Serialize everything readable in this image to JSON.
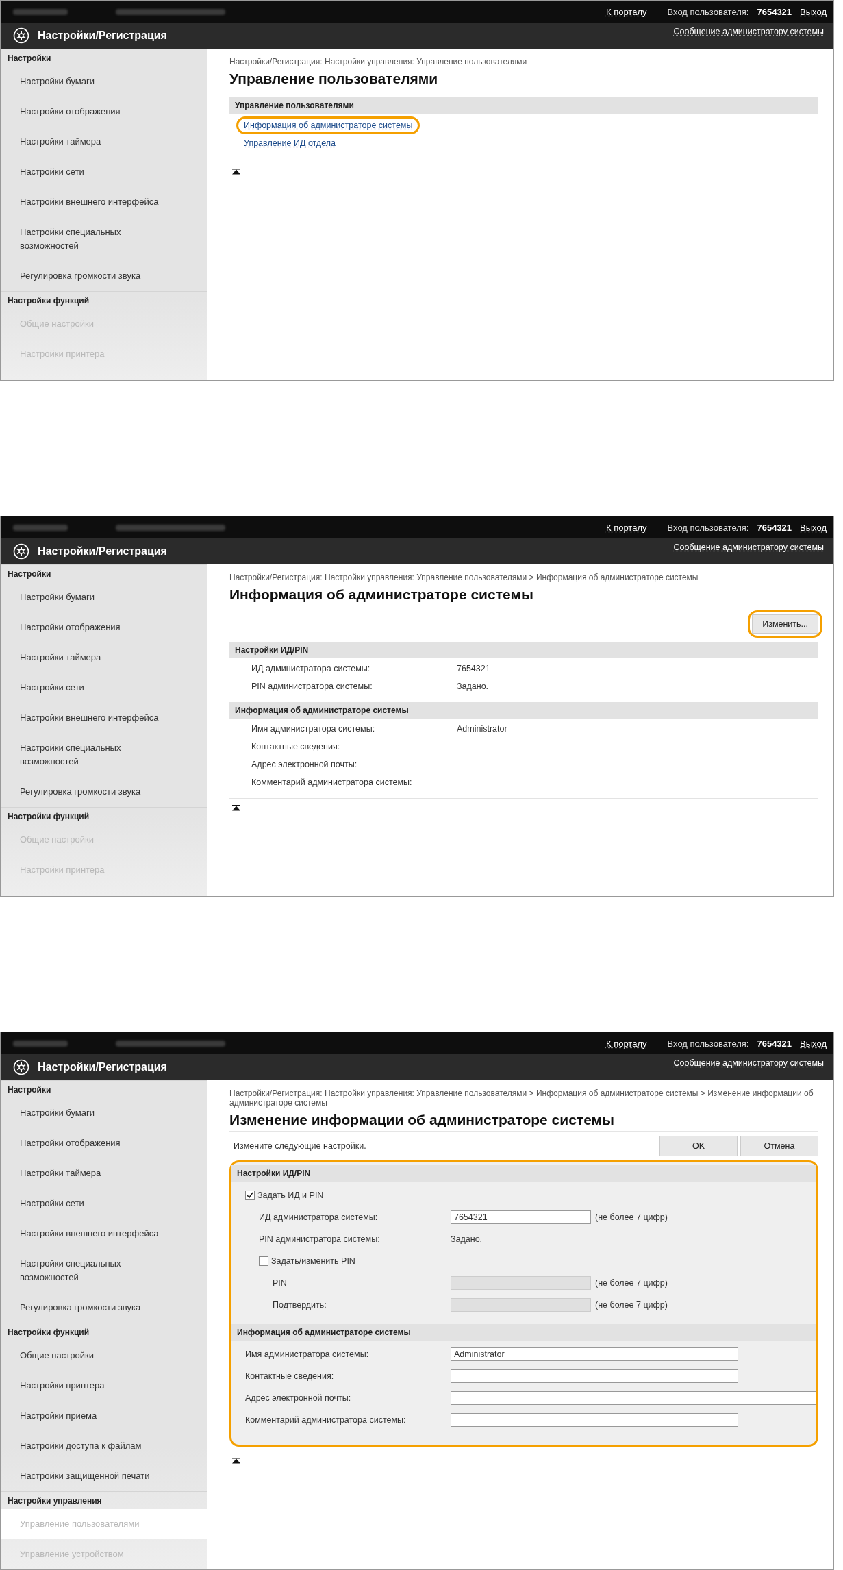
{
  "screens": [
    {
      "kind": "menu",
      "top_bar": {
        "portal_link": "К порталу",
        "login_label": "Вход пользователя:",
        "user": "7654321",
        "logout_link": "Выход"
      },
      "header": {
        "title": "Настройки/Регистрация",
        "message_link": "Сообщение администратору системы"
      },
      "sidebar": [
        {
          "heading": "Настройки",
          "items": [
            {
              "label": "Настройки бумаги",
              "selected": false,
              "faded": false
            },
            {
              "label": "Настройки отображения",
              "selected": false,
              "faded": false
            },
            {
              "label": "Настройки таймера",
              "selected": false,
              "faded": false
            },
            {
              "label": "Настройки сети",
              "selected": false,
              "faded": false
            },
            {
              "label": "Настройки внешнего интерфейса",
              "selected": false,
              "faded": false
            },
            {
              "label": "Настройки специальных возможностей",
              "selected": false,
              "faded": false
            },
            {
              "label": "Регулировка громкости звука",
              "selected": false,
              "faded": false
            }
          ]
        },
        {
          "heading": "Настройки функций",
          "items": [
            {
              "label": "Общие настройки",
              "selected": false,
              "faded": true
            },
            {
              "label": "Настройки принтера",
              "selected": false,
              "faded": true
            }
          ]
        }
      ],
      "breadcrumb": "Настройки/Регистрация: Настройки управления: Управление пользователями",
      "page_title": "Управление пользователями",
      "menu_section": {
        "heading": "Управление пользователями",
        "links": [
          {
            "label": "Информация об администраторе системы",
            "highlighted": true
          },
          {
            "label": "Управление ИД отдела",
            "highlighted": false
          }
        ]
      }
    },
    {
      "kind": "info",
      "top_bar": {
        "portal_link": "К порталу",
        "login_label": "Вход пользователя:",
        "user": "7654321",
        "logout_link": "Выход"
      },
      "header": {
        "title": "Настройки/Регистрация",
        "message_link": "Сообщение администратору системы"
      },
      "sidebar": [
        {
          "heading": "Настройки",
          "items": [
            {
              "label": "Настройки бумаги",
              "selected": false,
              "faded": false
            },
            {
              "label": "Настройки отображения",
              "selected": false,
              "faded": false
            },
            {
              "label": "Настройки таймера",
              "selected": false,
              "faded": false
            },
            {
              "label": "Настройки сети",
              "selected": false,
              "faded": false
            },
            {
              "label": "Настройки внешнего интерфейса",
              "selected": false,
              "faded": false
            },
            {
              "label": "Настройки специальных возможностей",
              "selected": false,
              "faded": false
            },
            {
              "label": "Регулировка громкости звука",
              "selected": false,
              "faded": false
            }
          ]
        },
        {
          "heading": "Настройки функций",
          "items": [
            {
              "label": "Общие настройки",
              "selected": false,
              "faded": true
            },
            {
              "label": "Настройки принтера",
              "selected": false,
              "faded": true
            }
          ]
        }
      ],
      "breadcrumb": "Настройки/Регистрация: Настройки управления: Управление пользователями > Информация об администраторе системы",
      "page_title": "Информация об администраторе системы",
      "edit_button": {
        "label": "Изменить...",
        "highlighted": true
      },
      "sections": [
        {
          "heading": "Настройки ИД/PIN",
          "rows": [
            {
              "label": "ИД администратора системы:",
              "value": "7654321"
            },
            {
              "label": "PIN администратора системы:",
              "value": "Задано."
            }
          ]
        },
        {
          "heading": "Информация об администраторе системы",
          "rows": [
            {
              "label": "Имя администратора системы:",
              "value": "Administrator"
            },
            {
              "label": "Контактные сведения:"
            },
            {
              "label": "Адрес электронной почты:"
            },
            {
              "label": "Комментарий администратора системы:"
            }
          ]
        }
      ]
    },
    {
      "kind": "form",
      "top_bar": {
        "portal_link": "К порталу",
        "login_label": "Вход пользователя:",
        "user": "7654321",
        "logout_link": "Выход"
      },
      "header": {
        "title": "Настройки/Регистрация",
        "message_link": "Сообщение администратору системы"
      },
      "sidebar": [
        {
          "heading": "Настройки",
          "items": [
            {
              "label": "Настройки бумаги",
              "selected": false,
              "faded": false
            },
            {
              "label": "Настройки отображения",
              "selected": false,
              "faded": false
            },
            {
              "label": "Настройки таймера",
              "selected": false,
              "faded": false
            },
            {
              "label": "Настройки сети",
              "selected": false,
              "faded": false
            },
            {
              "label": "Настройки внешнего интерфейса",
              "selected": false,
              "faded": false
            },
            {
              "label": "Настройки специальных возможностей",
              "selected": false,
              "faded": false
            },
            {
              "label": "Регулировка громкости звука",
              "selected": false,
              "faded": false
            }
          ]
        },
        {
          "heading": "Настройки функций",
          "items": [
            {
              "label": "Общие настройки",
              "selected": false,
              "faded": false
            },
            {
              "label": "Настройки принтера",
              "selected": false,
              "faded": false
            },
            {
              "label": "Настройки приема",
              "selected": false,
              "faded": false
            },
            {
              "label": "Настройки доступа к файлам",
              "selected": false,
              "faded": false
            },
            {
              "label": "Настройки защищенной печати",
              "selected": false,
              "faded": false
            }
          ]
        },
        {
          "heading": "Настройки управления",
          "items": [
            {
              "label": "Управление пользователями",
              "selected": true,
              "faded": true
            },
            {
              "label": "Управление устройством",
              "selected": false,
              "faded": true
            }
          ]
        }
      ],
      "breadcrumb": "Настройки/Регистрация: Настройки управления: Управление пользователями > Информация об администраторе системы > Изменение информации об администраторе системы",
      "page_title": "Изменение информации об администраторе системы",
      "instruction": "Измените следующие настройки.",
      "buttons": [
        "OK",
        "Отмена"
      ],
      "form": {
        "highlighted": true,
        "sections": [
          {
            "heading": "Настройки ИД/PIN",
            "rows": [
              {
                "kind": "checkbox",
                "label": "Задать ИД и PIN",
                "checked": true,
                "children": [
                  {
                    "kind": "input",
                    "label": "ИД администратора системы:",
                    "value": "7654321",
                    "disabled": false,
                    "hint": "(не более 7 цифр)"
                  },
                  {
                    "kind": "text",
                    "label": "PIN администратора системы:",
                    "value": "Задано."
                  },
                  {
                    "kind": "checkbox",
                    "label": "Задать/изменить PIN",
                    "checked": false,
                    "children": [
                      {
                        "kind": "input",
                        "label": "PIN",
                        "disabled": true,
                        "hint": "(не более 7 цифр)"
                      },
                      {
                        "kind": "input",
                        "label": "Подтвердить:",
                        "disabled": true,
                        "hint": "(не более 7 цифр)"
                      }
                    ]
                  }
                ]
              }
            ]
          },
          {
            "heading": "Информация об администраторе системы",
            "rows": [
              {
                "kind": "input",
                "label": "Имя администратора системы:",
                "value": "Administrator",
                "disabled": false
              },
              {
                "kind": "input",
                "label": "Контактные сведения:",
                "disabled": false
              },
              {
                "kind": "long_input",
                "label": "Адрес электронной почты:",
                "disabled": false
              },
              {
                "kind": "input",
                "label": "Комментарий администратора системы:",
                "disabled": false
              }
            ]
          }
        ]
      }
    }
  ]
}
